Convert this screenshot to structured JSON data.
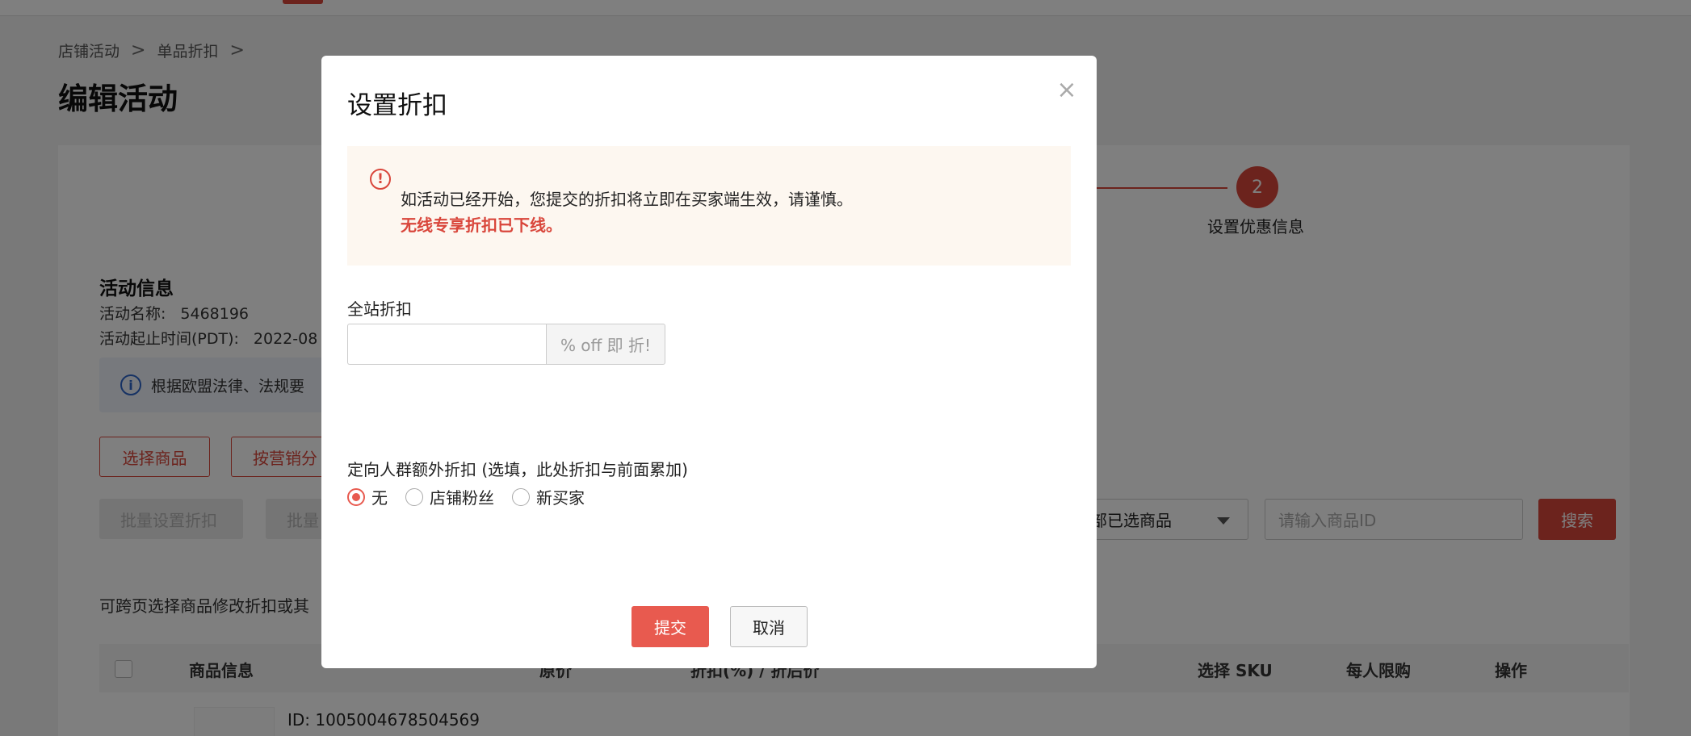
{
  "breadcrumb": {
    "items": [
      "店铺活动",
      "单品折扣"
    ],
    "separator": ">"
  },
  "page": {
    "title": "编辑活动"
  },
  "steps": {
    "current_number": "2",
    "current_label": "设置优惠信息"
  },
  "activity_info": {
    "title": "活动信息",
    "name_label": "活动名称:",
    "name_value": "5468196",
    "period_label": "活动起止时间(PDT):",
    "period_value": "2022-08"
  },
  "notice": {
    "text": "根据欧盟法律、法规要"
  },
  "buttons": {
    "select_products": "选择商品",
    "by_marketing": "按营销分",
    "batch_set_discount": "批量设置折扣",
    "batch_other": "批量"
  },
  "filter": {
    "select_value": "部已选商品",
    "search_placeholder": "请输入商品ID",
    "search_label": "搜索"
  },
  "hint": "可跨页选择商品修改折扣或其",
  "table": {
    "headers": [
      "商品信息",
      "原价",
      "折扣(%) / 折后价",
      "选择 SKU",
      "每人限购",
      "操作"
    ],
    "row_id": "ID: 1005004678504569"
  },
  "modal": {
    "title": "设置折扣",
    "close_glyph": "×",
    "warning": {
      "line1": "如活动已经开始，您提交的折扣将立即在买家端生效，请谨慎。",
      "line2": "无线专享折扣已下线。"
    },
    "sitewide_label": "全站折扣",
    "discount_value": "",
    "discount_addon": "% off 即 折!",
    "target_label": "定向人群额外折扣 (选填，此处折扣与前面累加)",
    "radio_options": [
      "无",
      "店铺粉丝",
      "新买家"
    ],
    "radio_selected": "无",
    "submit_label": "提交",
    "cancel_label": "取消"
  },
  "colors": {
    "accent": "#d9463b",
    "submit": "#e85a4f",
    "overlay": "rgba(0,0,0,0.5)"
  },
  "icons": {
    "warning": "exclamation-circle-icon",
    "info": "info-circle-icon",
    "close": "close-icon",
    "caret": "caret-down-icon"
  }
}
